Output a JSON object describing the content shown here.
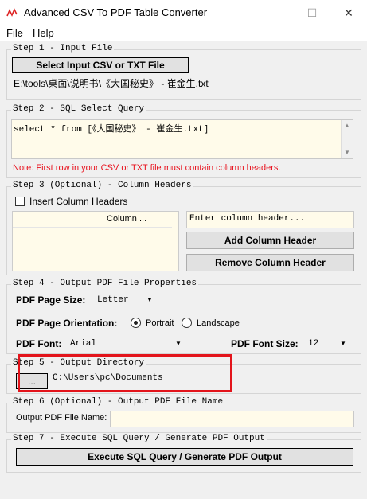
{
  "window": {
    "title": "Advanced CSV To PDF Table Converter",
    "minimize_glyph": "—",
    "maximize_glyph": "☐",
    "close_glyph": "✕"
  },
  "menu": {
    "items": [
      "File",
      "Help"
    ]
  },
  "step1": {
    "legend": "Step 1 - Input File",
    "button": "Select Input CSV or TXT File",
    "file_path": "E:\\tools\\桌面\\说明书\\《大国秘史》 - 崔金生.txt"
  },
  "step2": {
    "legend": "Step 2 - SQL Select Query",
    "query": "select * from [《大国秘史》 - 崔金生.txt]",
    "note": "Note: First row in your CSV or TXT file must contain column headers."
  },
  "step3": {
    "legend": "Step 3 (Optional) - Column Headers",
    "checkbox_label": "Insert Column Headers",
    "list_header": "Column ...",
    "input_placeholder": "Enter column header...",
    "add_button": "Add Column Header",
    "remove_button": "Remove Column Header"
  },
  "step4": {
    "legend": "Step 4 - Output PDF File Properties",
    "page_size_label": "PDF Page Size:",
    "page_size_value": "Letter",
    "orientation_label": "PDF Page Orientation:",
    "orientation_portrait": "Portrait",
    "orientation_landscape": "Landscape",
    "orientation_selected": "Portrait",
    "font_label": "PDF Font:",
    "font_value": "Arial",
    "font_size_label": "PDF Font Size:",
    "font_size_value": "12"
  },
  "step5": {
    "legend": "Step 5 - Output Directory",
    "browse_button": "...",
    "directory": "C:\\Users\\pc\\Documents"
  },
  "step6": {
    "legend": "Step 6 (Optional) - Output PDF File Name",
    "label": "Output PDF File Name:",
    "value": ""
  },
  "step7": {
    "legend": "Step 7 - Execute SQL Query / Generate PDF Output",
    "button": "Execute SQL Query / Generate PDF Output"
  },
  "colors": {
    "note_red": "#e8111d",
    "highlight_red": "#e3141b",
    "field_bg": "#fffbea"
  }
}
